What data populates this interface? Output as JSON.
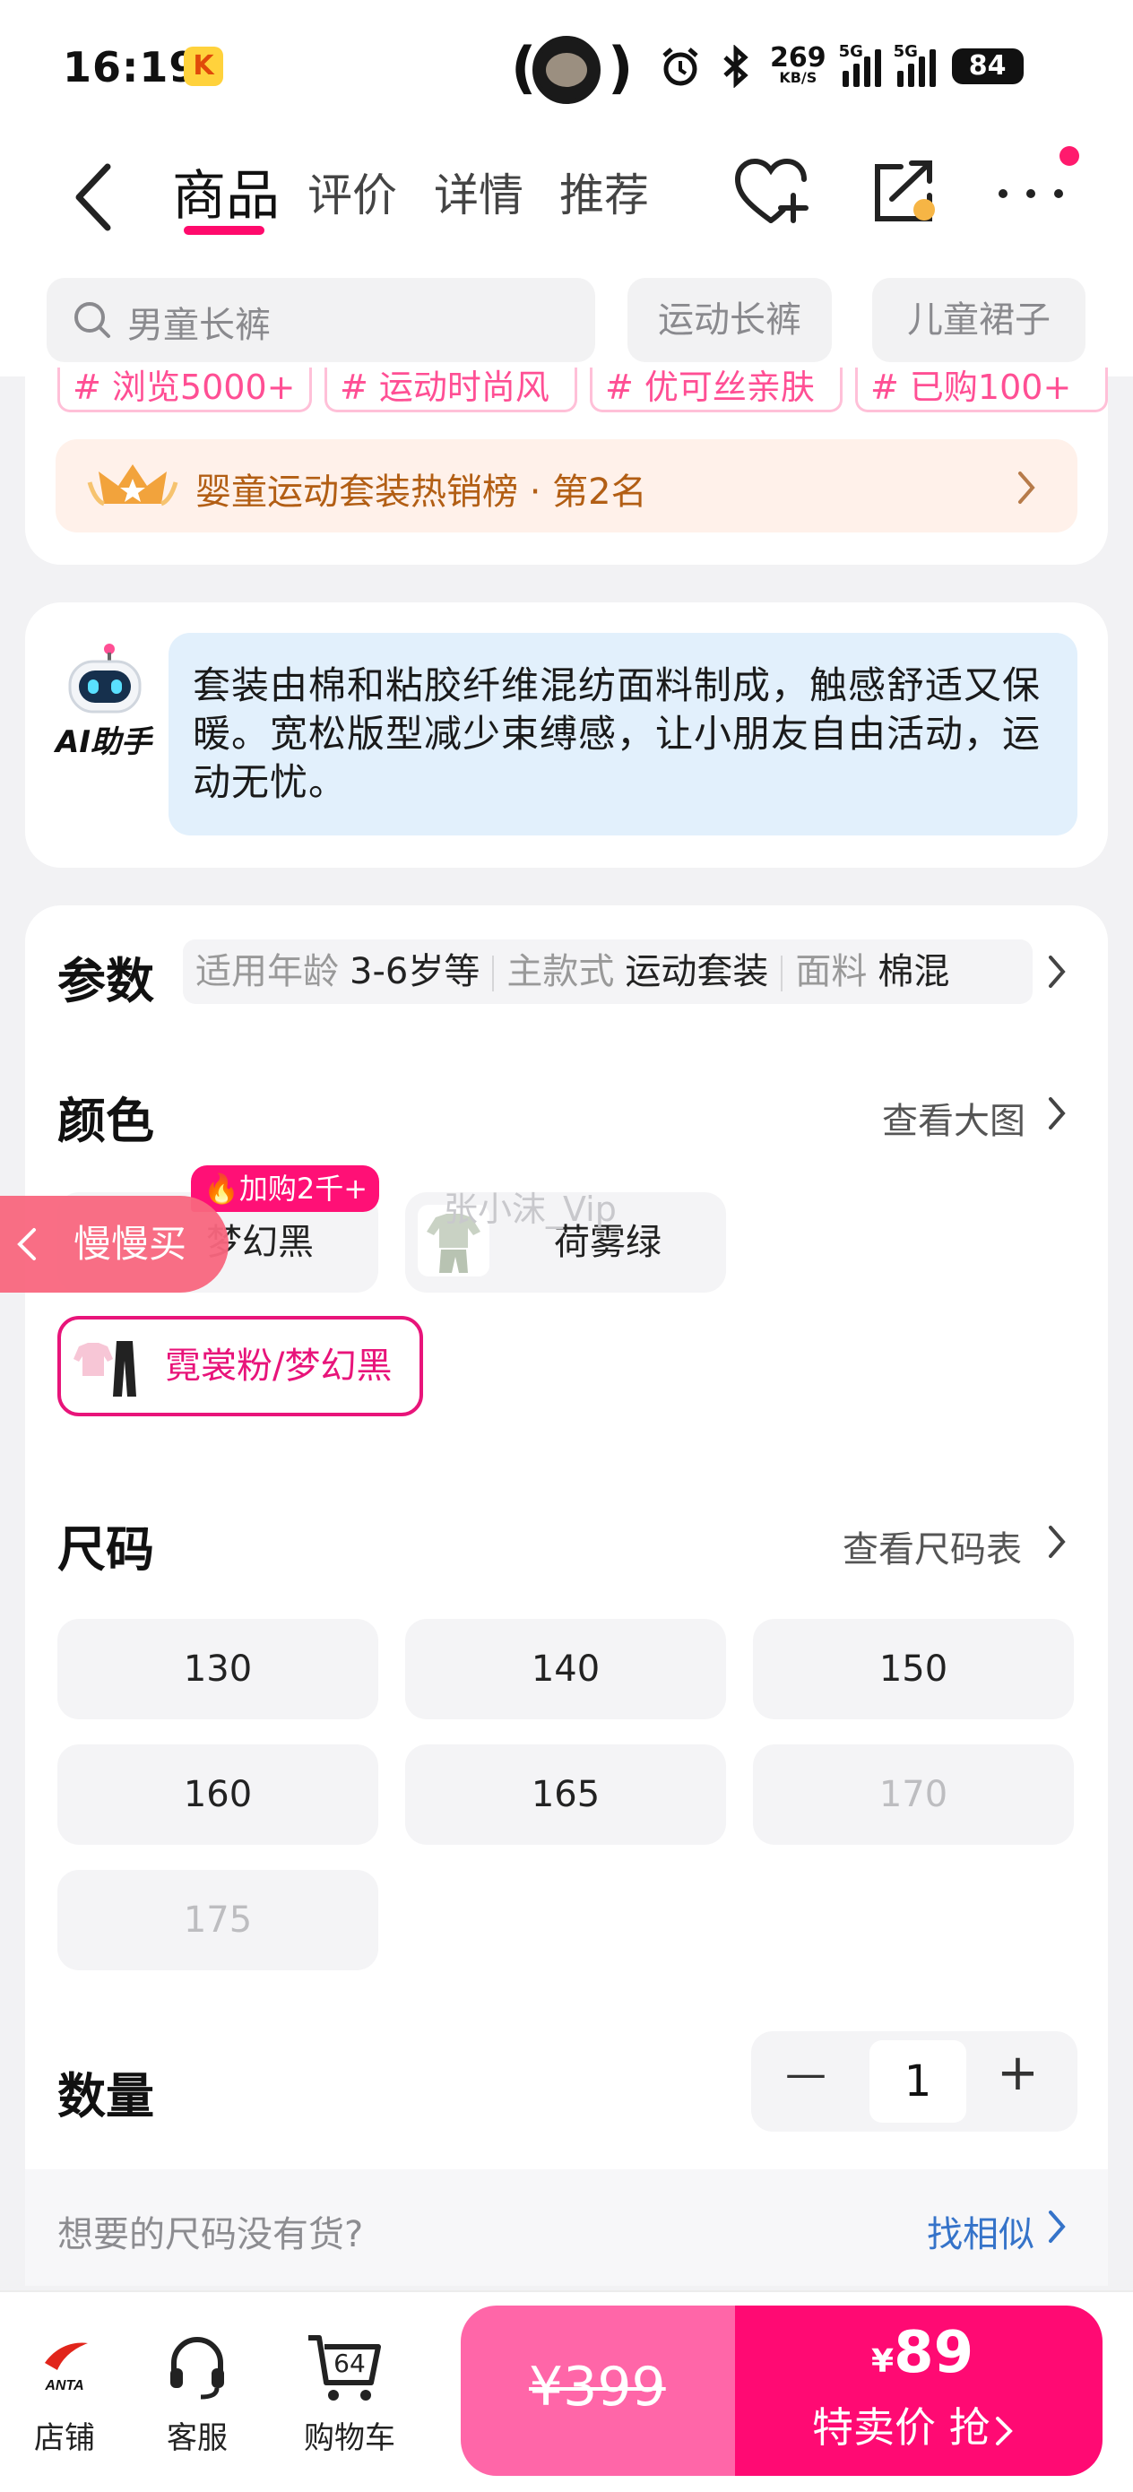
{
  "status_bar": {
    "time": "16:19",
    "app_icon_glyph": "K",
    "net_speed": "269",
    "net_speed_unit": "KB/S",
    "signal1_label": "5G",
    "signal2_label": "5G",
    "battery": "84"
  },
  "nav": {
    "tabs": [
      "商品",
      "评价",
      "详情",
      "推荐"
    ],
    "active_tab": 0
  },
  "search": {
    "placeholder": "男童长裤",
    "chips": [
      "运动长裤",
      "儿童裙子"
    ]
  },
  "tags": [
    "# 浏览5000+",
    "# 运动时尚风",
    "# 优可丝亲肤",
    "# 已购100+"
  ],
  "ranking": {
    "text": "婴童运动套装热销榜 · 第2名"
  },
  "ai_assistant": {
    "label": "AI助手",
    "text": "套装由棉和粘胶纤维混纺面料制成，触感舒适又保暖。宽松版型减少束缚感，让小朋友自由活动，运动无忧。"
  },
  "params": {
    "title": "参数",
    "items": [
      {
        "key": "适用年龄",
        "value": "3-6岁等"
      },
      {
        "key": "主款式",
        "value": "运动套装"
      },
      {
        "key": "面料",
        "value": "棉混"
      }
    ]
  },
  "color": {
    "title": "颜色",
    "link": "查看大图",
    "hot_badge": "加购2千+",
    "options": [
      {
        "label": "梦幻黑",
        "selected": false
      },
      {
        "label": "荷雾绿",
        "selected": false
      },
      {
        "label": "霓裳粉/梦幻黑",
        "selected": true
      }
    ]
  },
  "slow_buy": "慢慢买",
  "watermark": "张小沫_Vip",
  "size": {
    "title": "尺码",
    "link": "查看尺码表",
    "options": [
      {
        "label": "130",
        "available": true
      },
      {
        "label": "140",
        "available": true
      },
      {
        "label": "150",
        "available": true
      },
      {
        "label": "160",
        "available": true
      },
      {
        "label": "165",
        "available": true
      },
      {
        "label": "170",
        "available": false
      },
      {
        "label": "175",
        "available": false
      }
    ]
  },
  "quantity": {
    "title": "数量",
    "value": "1",
    "minus": "—",
    "plus": "+"
  },
  "notice": {
    "text": "想要的尺码没有货?",
    "link": "找相似"
  },
  "bottom_bar": {
    "store": "店铺",
    "store_logo": "ANTA",
    "service": "客服",
    "cart": "购物车",
    "cart_count": "64",
    "original_price": "¥399",
    "sale_currency": "¥",
    "sale_price": "89",
    "cta": "特卖价 抢"
  },
  "colors": {
    "accent_pink": "#ff0a73",
    "light_pink": "#ff66a8",
    "link_blue": "#3573c9",
    "rank_text": "#b25e14"
  }
}
